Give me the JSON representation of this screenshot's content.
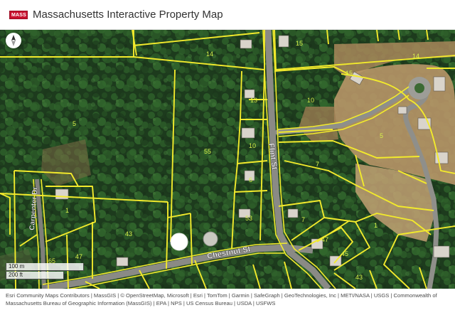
{
  "app": {
    "title": "Massachusetts Interactive Property Map",
    "logo_text": "MASS",
    "logo_color": "#c8102e"
  },
  "map": {
    "parcel_line_color": "#f2ea2c",
    "label_color": "#d8f24a",
    "street_label_color": "#ffffff",
    "streets": [
      {
        "name": "Flint St"
      },
      {
        "name": "Chestnut St"
      },
      {
        "name": "Carpenter Dr"
      }
    ],
    "parcel_labels": [
      "14",
      "15",
      "14",
      "15",
      "10",
      "5",
      "55",
      "13",
      "10",
      "6",
      "7",
      "5",
      "1",
      "53",
      "43",
      "7",
      "47",
      "45",
      "1",
      "47",
      "65",
      "43"
    ],
    "marker_icon": "white-circle-marker"
  },
  "controls": {
    "compass_icon": "north-arrow-icon"
  },
  "scalebar": {
    "metric": "100 m",
    "imperial": "200 ft"
  },
  "attribution": {
    "text": "Esri Community Maps Contributors | MassGIS | © OpenStreetMap, Microsoft | Esri | TomTom | Garmin | SafeGraph | GeoTechnologies, Inc | METI/NASA | USGS | Commonwealth of Massachusetts Bureau of Geographic Information (MassGIS) | EPA | NPS | US Census Bureau | USDA | USFWS"
  }
}
